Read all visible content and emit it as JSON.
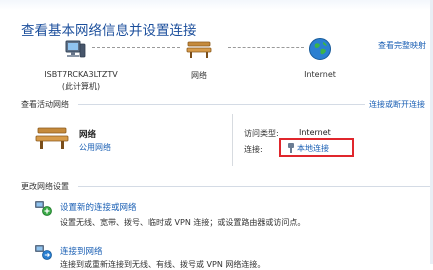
{
  "title": "查看基本网络信息并设置连接",
  "links": {
    "full_map": "查看完整映射",
    "connect_disconnect": "连接或断开连接"
  },
  "map": {
    "computer_name": "ISBT7RCKA3LTZTV",
    "computer_sub": "(此计算机)",
    "network": "网络",
    "internet": "Internet"
  },
  "active_networks": {
    "header": "查看活动网络",
    "name": "网络",
    "type_link": "公用网络",
    "access_type_label": "访问类型:",
    "access_type_value": "Internet",
    "connections_label": "连接:",
    "connection_value": "本地连接"
  },
  "change_settings": {
    "header": "更改网络设置",
    "tasks": [
      {
        "title": "设置新的连接或网络",
        "desc": "设置无线、宽带、拨号、临时或 VPN 连接；或设置路由器或访问点。"
      },
      {
        "title": "连接到网络",
        "desc": "连接到或重新连接到无线、有线、拨号或 VPN 网络连接。"
      }
    ]
  },
  "colors": {
    "title": "#1c4f9c",
    "link": "#1a5fb4",
    "highlight": "#e0262c"
  }
}
